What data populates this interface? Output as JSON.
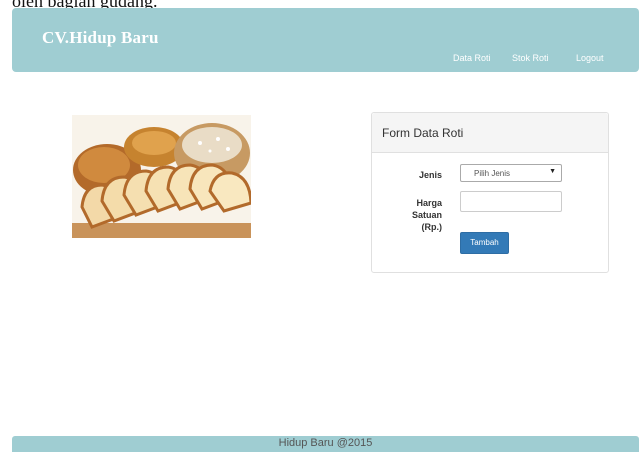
{
  "page": {
    "cropped_text_above": "oleh bagian gudang."
  },
  "header": {
    "brand": "CV.Hidup Baru",
    "nav": [
      {
        "label": "Data Roti"
      },
      {
        "label": "Stok Roti"
      },
      {
        "label": "Logout"
      }
    ]
  },
  "hero_image": {
    "description_icon": "bread-image"
  },
  "form": {
    "title": "Form Data Roti",
    "jenis_label": "Jenis",
    "jenis_selected": "Pilih Jenis",
    "harga_label_line1": "Harga Satuan",
    "harga_label_line2": "(Rp.)",
    "harga_value": "",
    "submit_label": "Tambah"
  },
  "footer": {
    "text": "Hidup Baru @2015"
  },
  "colors": {
    "navbar": "#9fcdd2",
    "button": "#337ab7"
  }
}
